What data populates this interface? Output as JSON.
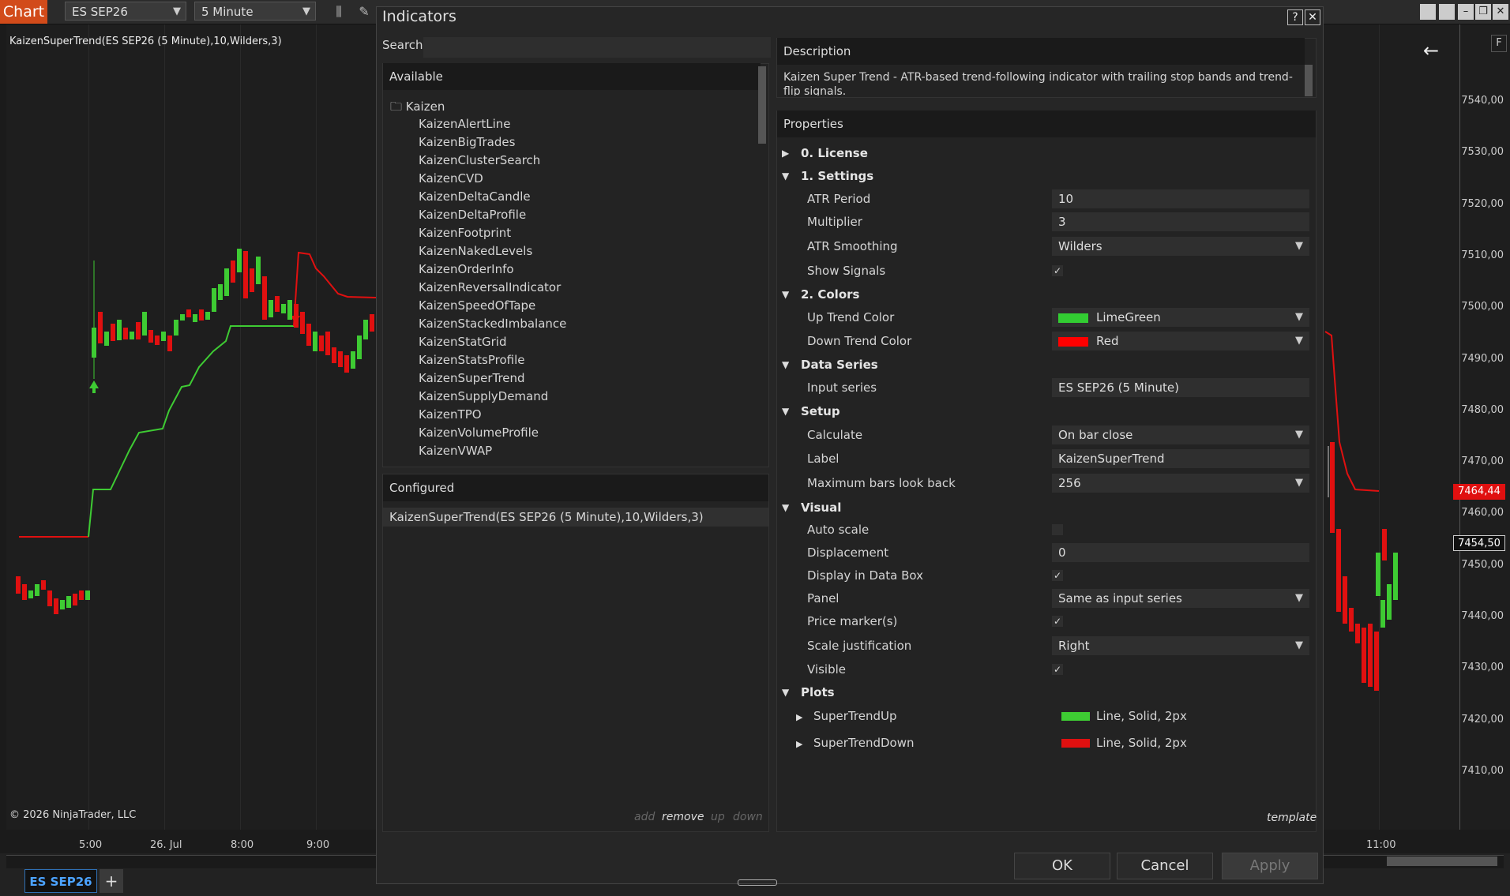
{
  "toolbar": {
    "chart_tab": "Chart",
    "instrument": "ES SEP26",
    "timeframe": "5 Minute"
  },
  "chart": {
    "indicator_label": "KaizenSuperTrend(ES SEP26 (5 Minute),10,Wilders,3)",
    "copyright": "© 2026 NinjaTrader, LLC",
    "price_labels": [
      "7540,00",
      "7530,00",
      "7520,00",
      "7510,00",
      "7500,00",
      "7490,00",
      "7480,00",
      "7470,00",
      "7460,00",
      "7450,00",
      "7440,00",
      "7430,00",
      "7420,00",
      "7410,00"
    ],
    "time_labels": [
      "5:00",
      "26. Jul",
      "8:00",
      "9:00",
      "11:00"
    ],
    "price_marker_red": "7464,44",
    "price_marker_last": "7454,50",
    "up_color": "#3ecb33",
    "down_color": "#e01010",
    "right_axis_letter": "F"
  },
  "bottom": {
    "instrument_tab": "ES SEP26",
    "add_tab": "+"
  },
  "dialog": {
    "title": "Indicators",
    "help": "?",
    "close": "✕",
    "search_label": "Search",
    "available_header": "Available",
    "folder": "Kaizen",
    "available": [
      "KaizenAlertLine",
      "KaizenBigTrades",
      "KaizenClusterSearch",
      "KaizenCVD",
      "KaizenDeltaCandle",
      "KaizenDeltaProfile",
      "KaizenFootprint",
      "KaizenNakedLevels",
      "KaizenOrderInfo",
      "KaizenReversalIndicator",
      "KaizenSpeedOfTape",
      "KaizenStackedImbalance",
      "KaizenStatGrid",
      "KaizenStatsProfile",
      "KaizenSuperTrend",
      "KaizenSupplyDemand",
      "KaizenTPO",
      "KaizenVolumeProfile",
      "KaizenVWAP"
    ],
    "configured_header": "Configured",
    "configured_item": "KaizenSuperTrend(ES SEP26 (5 Minute),10,Wilders,3)",
    "list_actions": {
      "add": "add",
      "remove": "remove",
      "up": "up",
      "down": "down"
    },
    "description_header": "Description",
    "description_text": "Kaizen Super Trend - ATR-based trend-following indicator with trailing stop bands and trend-flip signals.",
    "properties_header": "Properties",
    "categories": {
      "license": "0. License",
      "settings": "1. Settings",
      "colors": "2. Colors",
      "data_series": "Data Series",
      "setup": "Setup",
      "visual": "Visual",
      "plots": "Plots"
    },
    "props": {
      "atr_period": {
        "label": "ATR Period",
        "value": "10"
      },
      "multiplier": {
        "label": "Multiplier",
        "value": "3"
      },
      "atr_smoothing": {
        "label": "ATR Smoothing",
        "value": "Wilders"
      },
      "show_signals": {
        "label": "Show Signals",
        "value": "✓"
      },
      "up_trend_color": {
        "label": "Up Trend Color",
        "value": "LimeGreen",
        "color": "#32cd32"
      },
      "down_trend_color": {
        "label": "Down Trend Color",
        "value": "Red",
        "color": "#ff0000"
      },
      "input_series": {
        "label": "Input series",
        "value": "ES SEP26 (5 Minute)"
      },
      "calculate": {
        "label": "Calculate",
        "value": "On bar close"
      },
      "label": {
        "label": "Label",
        "value": "KaizenSuperTrend"
      },
      "max_bars": {
        "label": "Maximum bars look back",
        "value": "256"
      },
      "auto_scale": {
        "label": "Auto scale",
        "value": ""
      },
      "displacement": {
        "label": "Displacement",
        "value": "0"
      },
      "display_data_box": {
        "label": "Display in Data Box",
        "value": "✓"
      },
      "panel": {
        "label": "Panel",
        "value": "Same as input series"
      },
      "price_markers": {
        "label": "Price marker(s)",
        "value": "✓"
      },
      "scale_justification": {
        "label": "Scale justification",
        "value": "Right"
      },
      "visible": {
        "label": "Visible",
        "value": "✓"
      }
    },
    "plots": [
      {
        "name": "SuperTrendUp",
        "desc": "Line, Solid, 2px",
        "color": "#3ecb33"
      },
      {
        "name": "SuperTrendDown",
        "desc": "Line, Solid, 2px",
        "color": "#e01010"
      }
    ],
    "template_link": "template",
    "buttons": {
      "ok": "OK",
      "cancel": "Cancel",
      "apply": "Apply"
    }
  }
}
